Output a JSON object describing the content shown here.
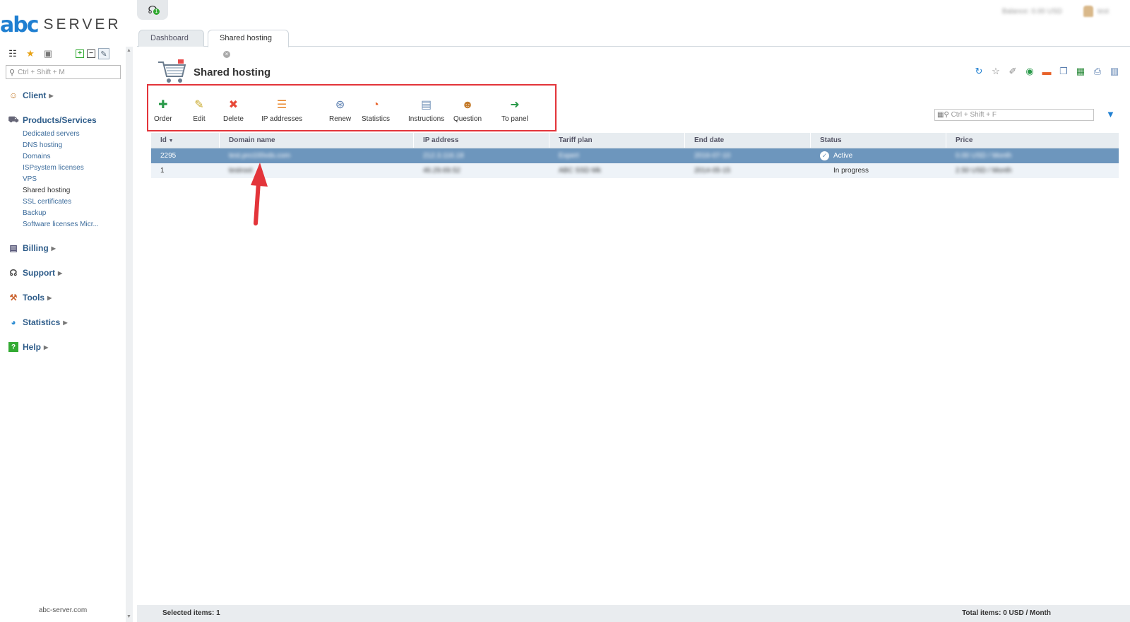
{
  "brand": {
    "mark": "abc",
    "name": "SERVER",
    "footer": "abc-server.com"
  },
  "sidebar": {
    "search_placeholder": "Ctrl + Shift + M",
    "sections": [
      {
        "label": "Client",
        "icon": "client-icon"
      },
      {
        "label": "Products/Services",
        "icon": "cart-icon",
        "items": [
          "Dedicated servers",
          "DNS hosting",
          "Domains",
          "ISPsystem licenses",
          "VPS",
          "Shared hosting",
          "SSL certificates",
          "Backup",
          "Software licenses Micr..."
        ]
      },
      {
        "label": "Billing",
        "icon": "billing-icon"
      },
      {
        "label": "Support",
        "icon": "headset-icon"
      },
      {
        "label": "Tools",
        "icon": "tools-icon"
      },
      {
        "label": "Statistics",
        "icon": "globe-icon"
      },
      {
        "label": "Help",
        "icon": "help-icon"
      }
    ]
  },
  "header": {
    "notifications_count": "1",
    "balance_blurred": "Balance: 0.00 USD",
    "user_blurred": "test"
  },
  "tabs": [
    {
      "label": "Dashboard"
    },
    {
      "label": "Shared hosting"
    }
  ],
  "page": {
    "title": "Shared hosting"
  },
  "toolbar": [
    {
      "label": "Order",
      "icon": "order-icon"
    },
    {
      "label": "Edit",
      "icon": "edit-icon"
    },
    {
      "label": "Delete",
      "icon": "delete-icon"
    },
    {
      "label": "IP addresses",
      "icon": "ip-addresses-icon"
    },
    {
      "label": "Renew",
      "icon": "renew-icon"
    },
    {
      "label": "Statistics",
      "icon": "statistics-icon"
    },
    {
      "label": "Instructions",
      "icon": "instructions-icon"
    },
    {
      "label": "Question",
      "icon": "question-icon"
    },
    {
      "label": "To panel",
      "icon": "to-panel-icon"
    }
  ],
  "table": {
    "search_placeholder": "Ctrl + Shift + F",
    "columns": [
      "Id",
      "Domain name",
      "IP address",
      "Tariff plan",
      "End date",
      "Status",
      "Price"
    ],
    "rows": [
      {
        "id": "2295",
        "domain": "test.pro100vds.com",
        "ip": "212.3.116.18",
        "tariff": "Expert",
        "end": "2016-07-10",
        "status": "Active",
        "price": "0.00 USD / Month"
      },
      {
        "id": "1",
        "domain": "testroot",
        "ip": "46.29.69.52",
        "tariff": "ABC SSD Mk",
        "end": "2014-05-15",
        "status": "In progress",
        "price": "2.50 USD / Month"
      }
    ]
  },
  "footer": {
    "selected": "Selected items: 1",
    "total": "Total items: 0 USD / Month"
  },
  "colors": {
    "accent": "#1f7fd1",
    "highlight_box": "#e3343a",
    "selected_row": "#6d96bd"
  }
}
